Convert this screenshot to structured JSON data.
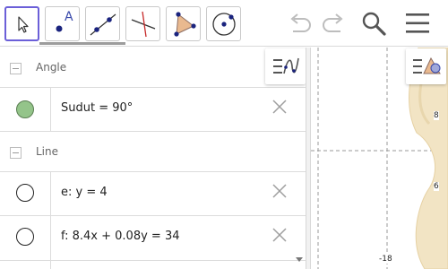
{
  "toolbar": {
    "tools": [
      {
        "name": "move-tool",
        "icon": "cursor-arrow-icon",
        "selected": true
      },
      {
        "name": "point-tool",
        "icon": "point-A-icon",
        "label": "A"
      },
      {
        "name": "line-tool",
        "icon": "line-through-points-icon"
      },
      {
        "name": "perpendicular-tool",
        "icon": "perpendicular-line-icon"
      },
      {
        "name": "polygon-tool",
        "icon": "polygon-icon"
      },
      {
        "name": "circle-tool",
        "icon": "circle-center-point-icon"
      }
    ],
    "right": [
      "undo-icon",
      "redo-icon",
      "search-icon",
      "menu-icon"
    ]
  },
  "algebra": {
    "groups": [
      {
        "label": "Angle",
        "items": [
          {
            "text": "Sudut = 90°",
            "visible": true,
            "color": "#94c48a"
          }
        ]
      },
      {
        "label": "Line",
        "items": [
          {
            "text": "e: y = 4",
            "visible": false
          },
          {
            "text": "f: 8.4x + 0.08y = 34",
            "visible": false
          }
        ]
      }
    ]
  },
  "graphics": {
    "y_ticks": [
      "8",
      "6"
    ],
    "x_ticks": [
      "-18"
    ]
  },
  "colors": {
    "accent": "#6b5fd8",
    "marble_on": "#94c48a",
    "grid": "#9a9a9a",
    "shape_fill": "#f2e4c4"
  }
}
